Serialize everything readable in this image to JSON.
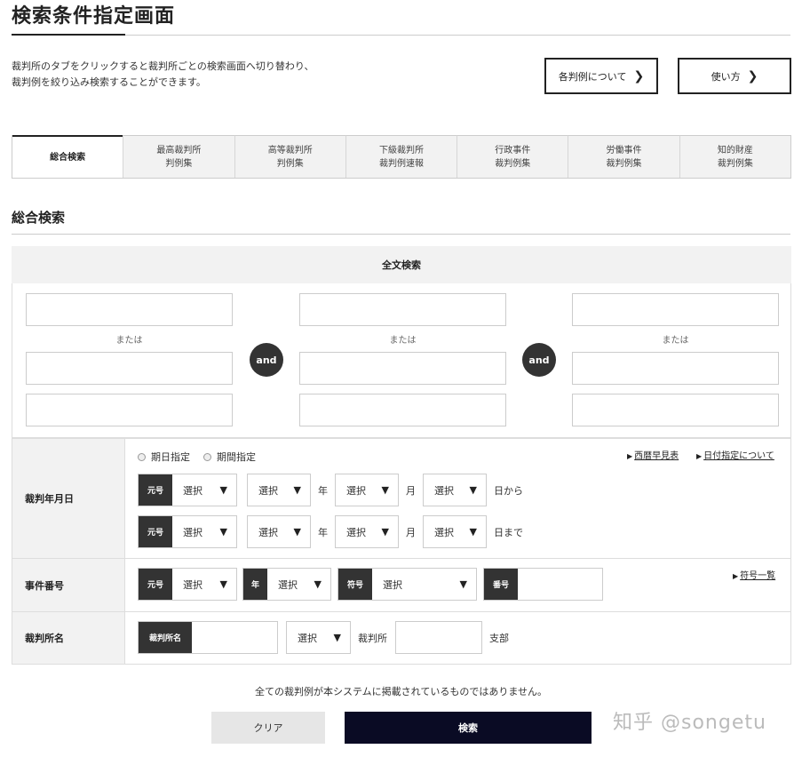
{
  "page": {
    "title": "検索条件指定画面",
    "desc_line1": "裁判所のタブをクリックすると裁判所ごとの検索画面へ切り替わり、",
    "desc_line2": "裁判例を絞り込み検索することができます。"
  },
  "top_buttons": {
    "hanrei": "各判例について",
    "usage": "使い方"
  },
  "tabs": [
    {
      "label": "総合検索"
    },
    {
      "label": "最高裁判所\n判例集"
    },
    {
      "label": "高等裁判所\n判例集"
    },
    {
      "label": "下級裁判所\n裁判例速報"
    },
    {
      "label": "行政事件\n裁判例集"
    },
    {
      "label": "労働事件\n裁判例集"
    },
    {
      "label": "知的財産\n裁判例集"
    }
  ],
  "section_title": "総合検索",
  "fulltext": {
    "header": "全文検索",
    "or_label": "または",
    "and_label": "and"
  },
  "date_row": {
    "label": "裁判年月日",
    "radio_day": "期日指定",
    "radio_period": "期間指定",
    "link_calendar": "西暦早見表",
    "link_date": "日付指定について",
    "era_tag": "元号",
    "select_label": "選択",
    "unit_year": "年",
    "unit_month": "月",
    "unit_from": "日から",
    "unit_to": "日まで"
  },
  "case_row": {
    "label": "事件番号",
    "era_tag": "元号",
    "year_tag": "年",
    "code_tag": "符号",
    "num_tag": "番号",
    "select_label": "選択",
    "link_codes": "符号一覧"
  },
  "court_row": {
    "label": "裁判所名",
    "court_tag": "裁判所名",
    "select_label": "選択",
    "unit_court": "裁判所",
    "unit_branch": "支部"
  },
  "notice": "全ての裁判例が本システムに掲載されているものではありません。",
  "actions": {
    "clear": "クリア",
    "search": "検索"
  },
  "watermark": "知乎 @songetu"
}
